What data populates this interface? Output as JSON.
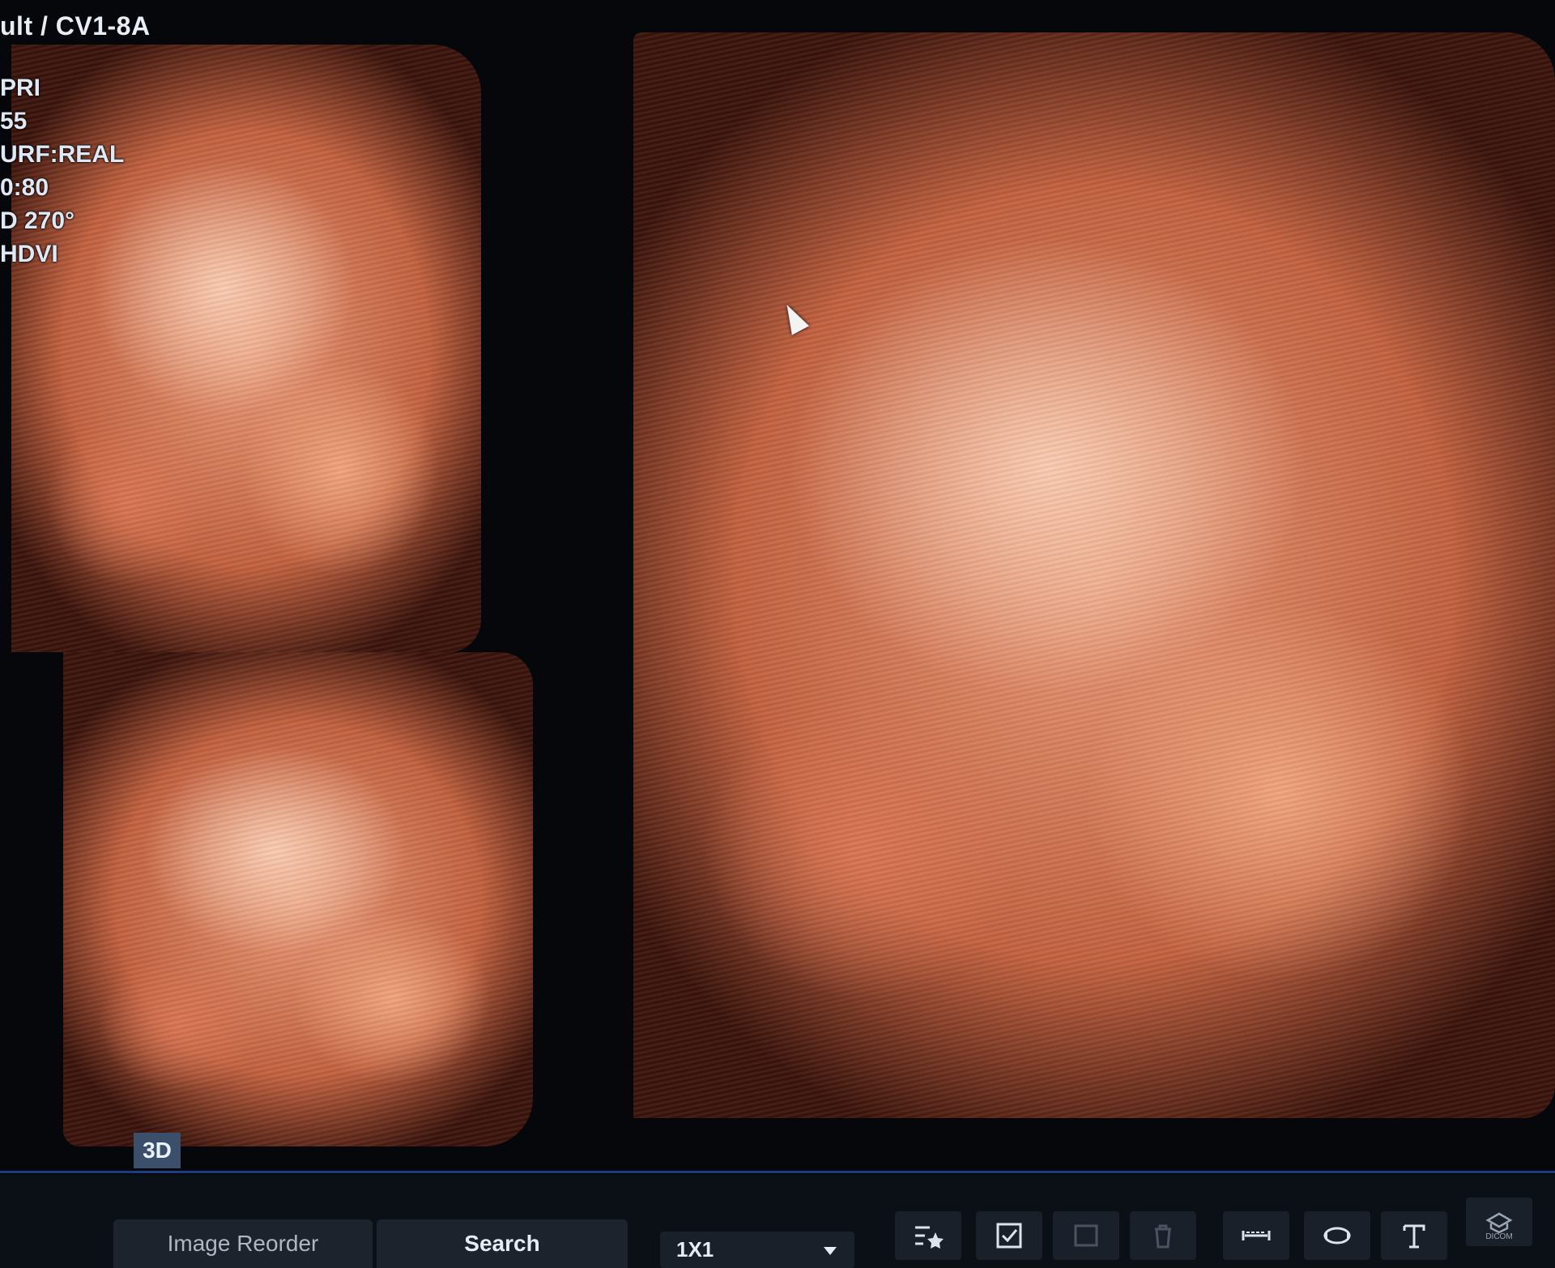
{
  "header": {
    "probe": "ult / CV1-8A"
  },
  "params": [
    "PRI",
    "55",
    "URF:REAL",
    "0:80",
    "D 270°",
    "HDVI"
  ],
  "views": {
    "mode_badge": "3D"
  },
  "toolbar": {
    "tabs": [
      {
        "label": "Image Reorder",
        "active": false
      },
      {
        "label": "Search",
        "active": true
      }
    ],
    "layout_select": {
      "value": "1X1"
    },
    "tool_icons": [
      "annotation-star-icon",
      "checkbox-icon",
      "square-icon",
      "trash-icon",
      "measure-distance-icon",
      "rotate-icon",
      "text-tool-icon",
      "dicom-icon"
    ],
    "dicom_label": "DICOM"
  },
  "colors": {
    "background": "#05070b",
    "accent": "#1b3d86",
    "tissue": "#e99a78"
  }
}
